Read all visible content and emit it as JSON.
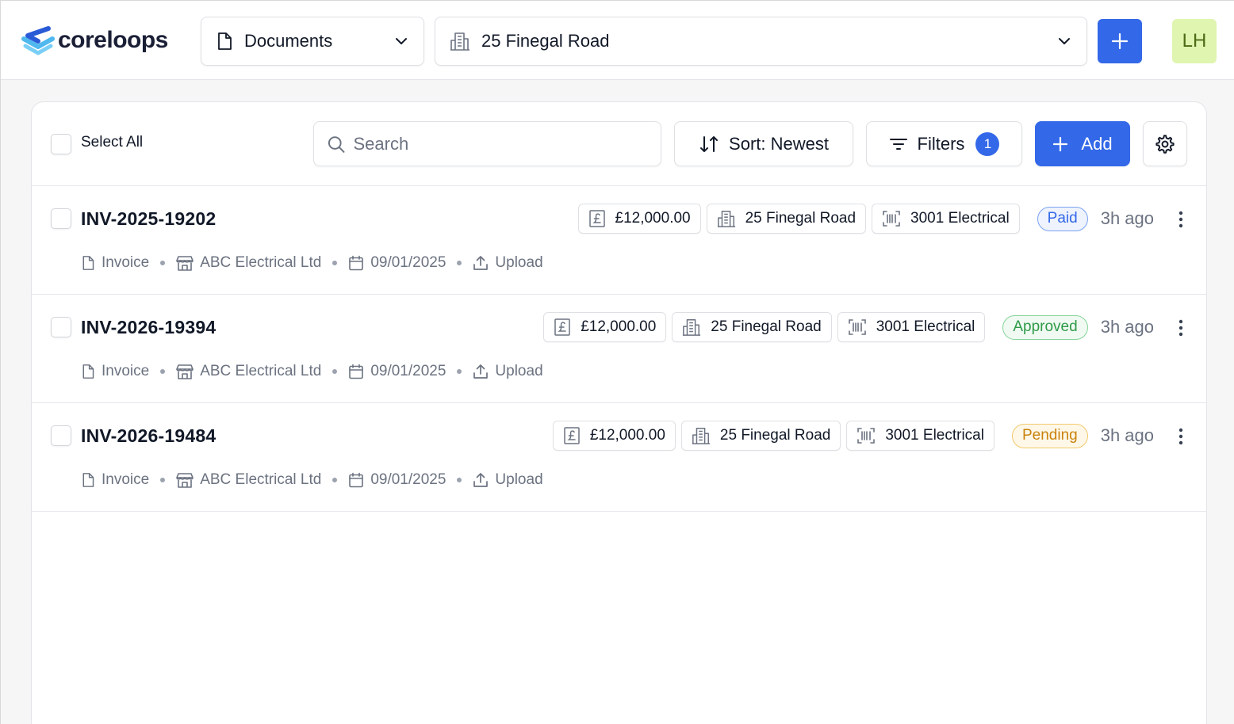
{
  "header": {
    "logo_text": "coreloops",
    "document_type": "Documents",
    "property": "25 Finegal Road",
    "avatar_initials": "LH"
  },
  "toolbar": {
    "select_all_label": "Select All",
    "search_placeholder": "Search",
    "sort_label": "Sort: Newest",
    "filters_label": "Filters",
    "filters_count": "1",
    "add_label": "Add"
  },
  "documents": [
    {
      "id": "INV-2025-19202",
      "amount": "£12,000.00",
      "property": "25 Finegal Road",
      "category": "3001 Electrical",
      "status": "Paid",
      "time": "3h ago",
      "type": "Invoice",
      "supplier": "ABC Electrical Ltd",
      "date": "09/01/2025",
      "source": "Upload"
    },
    {
      "id": "INV-2026-19394",
      "amount": "£12,000.00",
      "property": "25 Finegal Road",
      "category": "3001 Electrical",
      "status": "Approved",
      "time": "3h ago",
      "type": "Invoice",
      "supplier": "ABC Electrical Ltd",
      "date": "09/01/2025",
      "source": "Upload"
    },
    {
      "id": "INV-2026-19484",
      "amount": "£12,000.00",
      "property": "25 Finegal Road",
      "category": "3001 Electrical",
      "status": "Pending",
      "time": "3h ago",
      "type": "Invoice",
      "supplier": "ABC Electrical Ltd",
      "date": "09/01/2025",
      "source": "Upload"
    }
  ],
  "colors": {
    "accent": "#3368e8",
    "paid": "#3368e8",
    "approved": "#2f9a48",
    "pending": "#c9820c",
    "avatar_bg": "#dff5b0"
  }
}
